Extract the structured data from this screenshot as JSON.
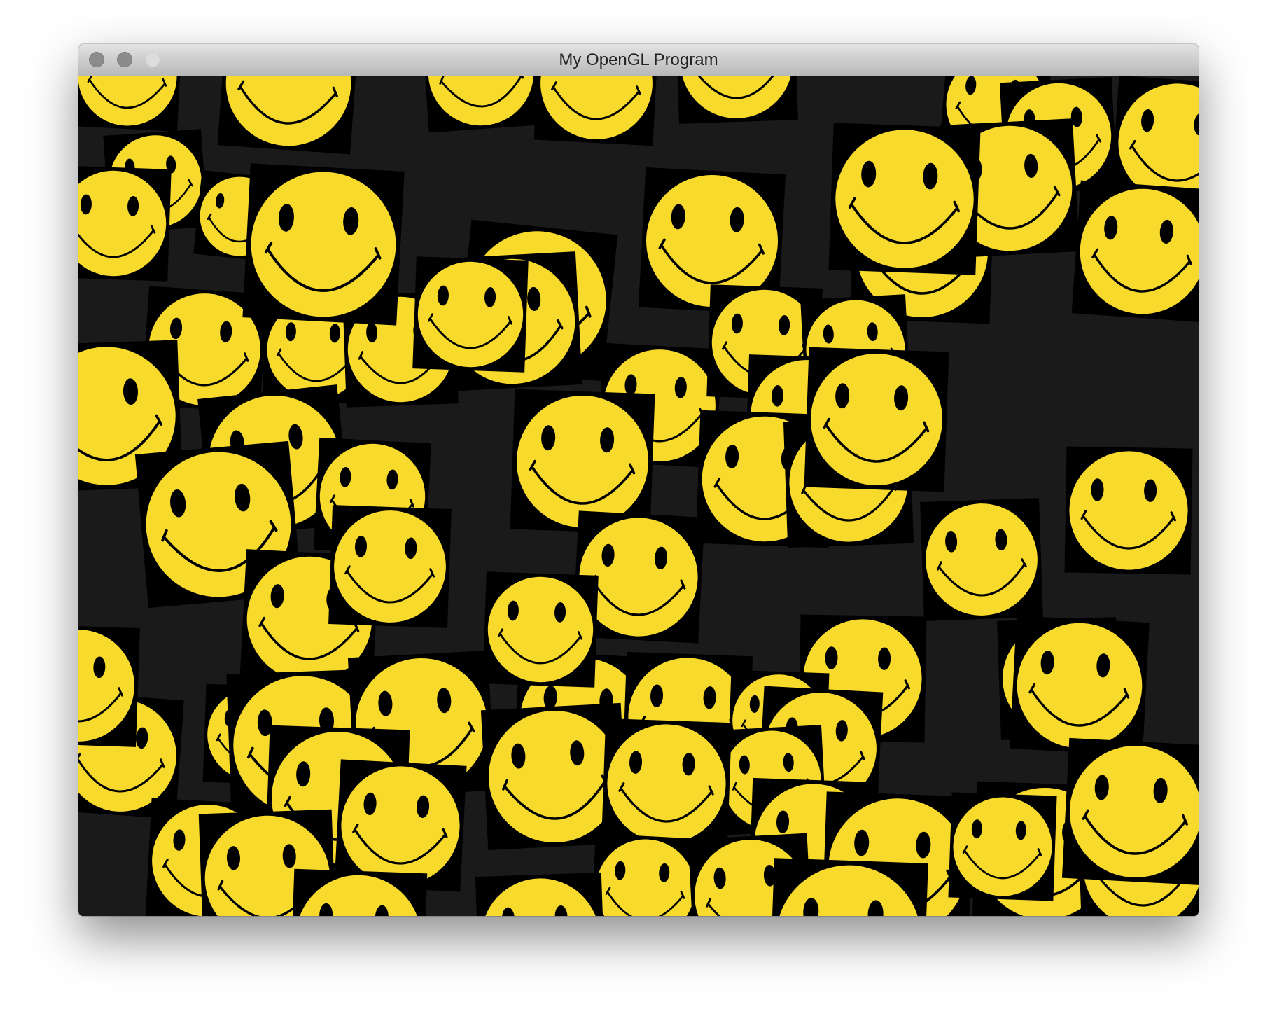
{
  "window": {
    "title": "My OpenGL Program",
    "controls": [
      "close",
      "minimize",
      "zoom"
    ]
  },
  "viewport": {
    "background_color": "#1a1a1a",
    "sprite": {
      "icon": "smiley-face-icon",
      "face_color": "#f7da2c",
      "quad_color": "#000000",
      "feature_color": "#000000"
    }
  }
}
